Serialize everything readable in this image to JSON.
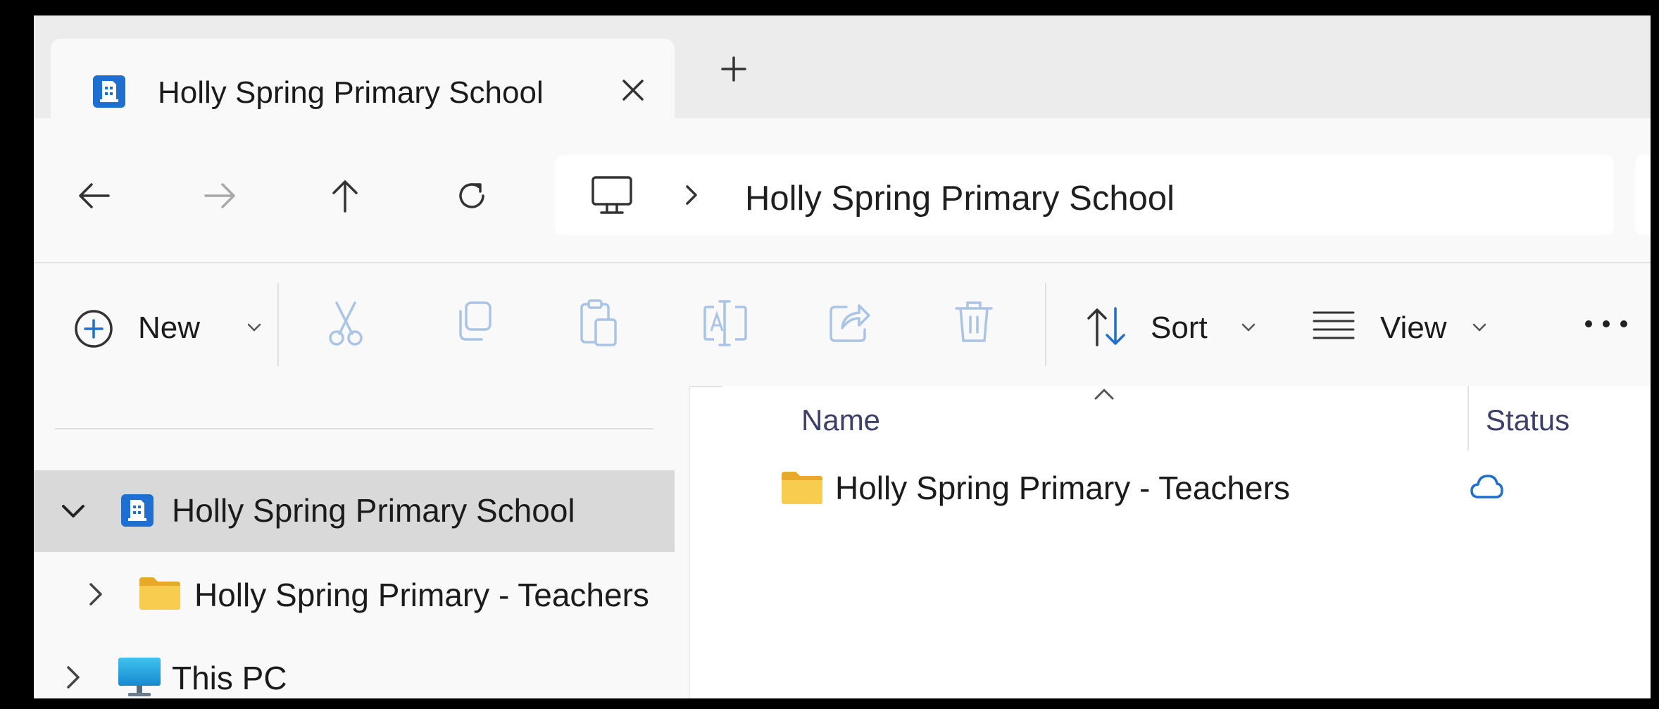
{
  "tab": {
    "title": "Holly Spring Primary School"
  },
  "address": {
    "breadcrumb": "Holly Spring Primary School"
  },
  "commands": {
    "new_label": "New",
    "sort_label": "Sort",
    "view_label": "View"
  },
  "nav_tree": [
    {
      "label": "Holly Spring Primary School",
      "icon": "sharepoint-library-icon",
      "expanded": true,
      "selected": true
    },
    {
      "label": "Holly Spring Primary - Teachers",
      "icon": "folder-icon",
      "expanded": false,
      "selected": false
    },
    {
      "label": "This PC",
      "icon": "monitor-icon",
      "expanded": false,
      "selected": false
    }
  ],
  "columns": {
    "name": "Name",
    "status": "Status"
  },
  "files": [
    {
      "name": "Holly Spring Primary - Teachers",
      "type": "folder",
      "status": "cloud"
    }
  ],
  "colors": {
    "accent": "#1f6fd1",
    "folder": "#f5c542",
    "selected_row": "#d9d9d9",
    "disabled_icon": "#a9c4e6"
  }
}
